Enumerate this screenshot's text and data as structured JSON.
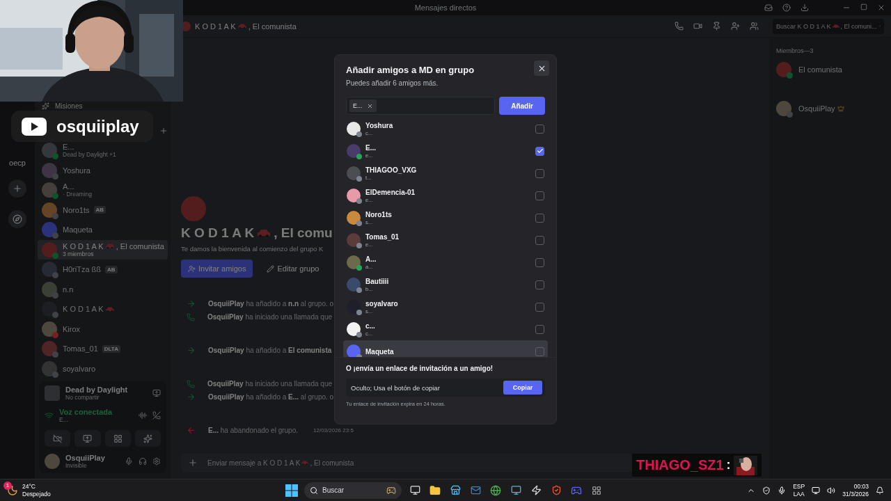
{
  "window": {
    "title": "Mensajes directos"
  },
  "server_rail": {
    "label": "oecp"
  },
  "dm_list": {
    "missions": "Misiones",
    "items": [
      {
        "name": "E...",
        "activity": "Dead by Daylight +1",
        "color": "#11522d",
        "selected": false,
        "car": false
      },
      {
        "name": "Yoshura",
        "color": "#404247",
        "selected": false,
        "car": false
      },
      {
        "name": "A...",
        "activity": "· Dreaming",
        "color": "#11522d",
        "selected": false,
        "car": false
      },
      {
        "name": "Noro1ts",
        "tag": "AB",
        "color": "#404247",
        "selected": false,
        "car": false
      },
      {
        "name": "Maqueta",
        "color": "#404247",
        "selected": false,
        "car": false
      },
      {
        "name": "K O D 1 A K",
        "name_end": ", El comunista",
        "activity": "3 miembros",
        "color": "#11522d",
        "selected": true,
        "car": true
      },
      {
        "name": "H0riTza ßß",
        "tag": "AB",
        "color": "#404247",
        "selected": false,
        "car": false
      },
      {
        "name": "n.n",
        "color": "#404247",
        "selected": false,
        "car": false
      },
      {
        "name": "K O D 1 A K",
        "color": "#404247",
        "selected": false,
        "car": true
      },
      {
        "name": "Kirox",
        "color": "#791f21",
        "selected": false,
        "car": false
      },
      {
        "name": "Tomas_01",
        "tag": "DLTA",
        "color": "#404247",
        "selected": false,
        "car": false
      },
      {
        "name": "soyalvaro",
        "color": "#404247",
        "selected": false,
        "car": false
      }
    ]
  },
  "voice_panel": {
    "activity": {
      "title": "Dead by Daylight",
      "subtitle": "No compartir"
    },
    "voice": {
      "title": "Voz conectada",
      "subtitle": "E..."
    },
    "user": {
      "name": "OsquiiPlay",
      "status_text": "Invisible"
    }
  },
  "channel": {
    "name": "K O D 1 A K",
    "name_end": ", El comunista",
    "search": {
      "placeholder": "Buscar K O D 1 A K",
      "placeholder_end": ", El comuni..."
    }
  },
  "welcome": {
    "title": "K O D 1 A K",
    "title_end": ", El comu",
    "text": "Te damos la bienvenida al comienzo del grupo K",
    "buttons": [
      {
        "label": "Invitar amigos",
        "kind": "primary"
      },
      {
        "label": "Editar grupo",
        "kind": "secondary"
      }
    ]
  },
  "messages": [
    {
      "kind": "added",
      "text": "**OsquiiPlay** ha añadido a **n.n** al grupo. o"
    },
    {
      "kind": "call",
      "text": "**OsquiiPlay** ha iniciado una llamada que"
    },
    {
      "kind": "added",
      "text": "**OsquiiPlay** ha añadido a **El comunista**"
    },
    {
      "kind": "call",
      "text": "**OsquiiPlay** ha iniciado una llamada que"
    },
    {
      "kind": "added",
      "text": "**OsquiiPlay** ha añadido a **E...** al grupo. o"
    },
    {
      "kind": "left",
      "text": "**E...** ha abandonado el grupo.",
      "time": "12/03/2026 23:5"
    }
  ],
  "composer": {
    "placeholder": "Enviar mensaje a K O D 1 A K",
    "placeholder_end": ", El comunista"
  },
  "members": {
    "heading": "Miembros—3",
    "items": [
      {
        "name": "El comunista",
        "color": "#11522d",
        "owner": false
      },
      {
        "name": "OsquiiPlay",
        "color": "#404247",
        "owner": true
      }
    ]
  },
  "modal": {
    "title": "Añadir amigos a MD en grupo",
    "subtitle": "Puedes añadir 6 amigos más.",
    "chips": [
      "E..."
    ],
    "add_button": "Añadir",
    "friends": [
      {
        "name": "Yoshura",
        "handle": "c...",
        "color": "#80848e",
        "checked": false,
        "hovered": false
      },
      {
        "name": "E...",
        "handle": "e...",
        "color": "#23a55a",
        "checked": true,
        "hovered": false
      },
      {
        "name": "THIAGOO_VXG",
        "handle": "t...",
        "color": "#80848e",
        "checked": false,
        "hovered": false
      },
      {
        "name": "ElDemencia-01",
        "handle": "e...",
        "color": "#80848e",
        "checked": false,
        "hovered": false
      },
      {
        "name": "Noro1ts",
        "handle": "s...",
        "color": "#80848e",
        "checked": false,
        "hovered": false
      },
      {
        "name": "Tomas_01",
        "handle": "e...",
        "color": "#80848e",
        "checked": false,
        "hovered": false
      },
      {
        "name": "A...",
        "handle": "a...",
        "color": "#23a55a",
        "checked": false,
        "hovered": false
      },
      {
        "name": "Bautiiii",
        "handle": "b...",
        "color": "#80848e",
        "checked": false,
        "hovered": false
      },
      {
        "name": "soyalvaro",
        "handle": "s...",
        "color": "#80848e",
        "checked": false,
        "hovered": false
      },
      {
        "name": "c...",
        "handle": "c...",
        "color": "#80848e",
        "checked": false,
        "hovered": false
      },
      {
        "name": "Maqueta",
        "color": "#80848e",
        "checked": false,
        "hovered": true
      }
    ],
    "invite_heading": "O ¡envía un enlace de invitación a un amigo!",
    "invite_value": "Oculto; Usa el botón de copiar",
    "copy_button": "Copiar",
    "expiry": "Tu enlace de invitación expira en 24 horas."
  },
  "overlays": {
    "channel_name": "osquiiplay",
    "chat_user": "THIAGO_SZ1",
    "chat_separator": ":"
  },
  "taskbar": {
    "temperature": "24°C",
    "weather": "Despejado",
    "weather_badge": "1",
    "search": "Buscar",
    "language": "ESP",
    "layout": "LAA",
    "time": "00:03",
    "date": "31/3/2026"
  }
}
